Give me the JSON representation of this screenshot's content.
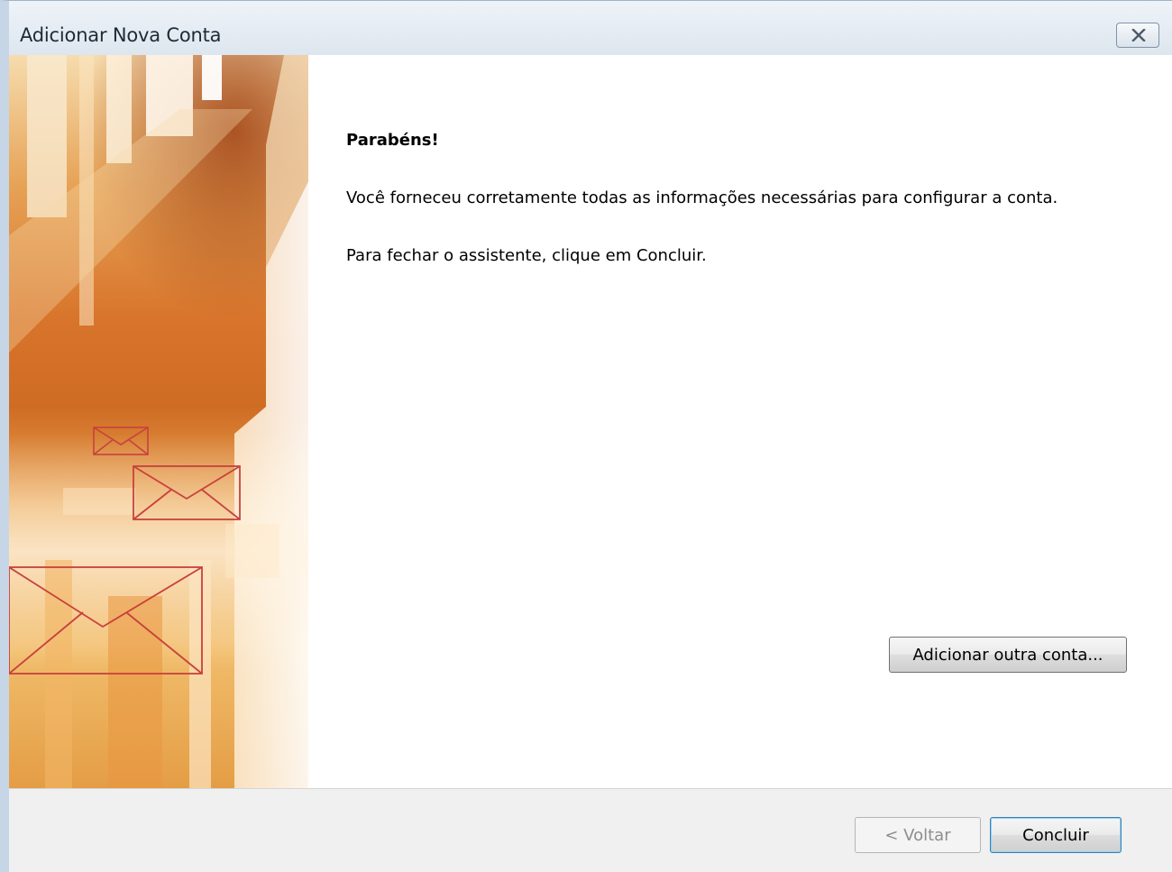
{
  "window": {
    "title": "Adicionar Nova Conta"
  },
  "content": {
    "heading": "Parabéns!",
    "paragraph_1": "Você forneceu corretamente todas as informações necessárias para configurar a conta.",
    "paragraph_2": "Para fechar o assistente, clique em Concluir."
  },
  "buttons": {
    "add_another": "Adicionar outra conta...",
    "back": "< Voltar",
    "finish": "Concluir"
  },
  "icons": {
    "close": "close-icon",
    "envelope": "envelope-icon"
  },
  "colors": {
    "banner_orange": "#e07a2a",
    "banner_light": "#f5d7a0",
    "envelope_stroke": "#c8413c"
  }
}
